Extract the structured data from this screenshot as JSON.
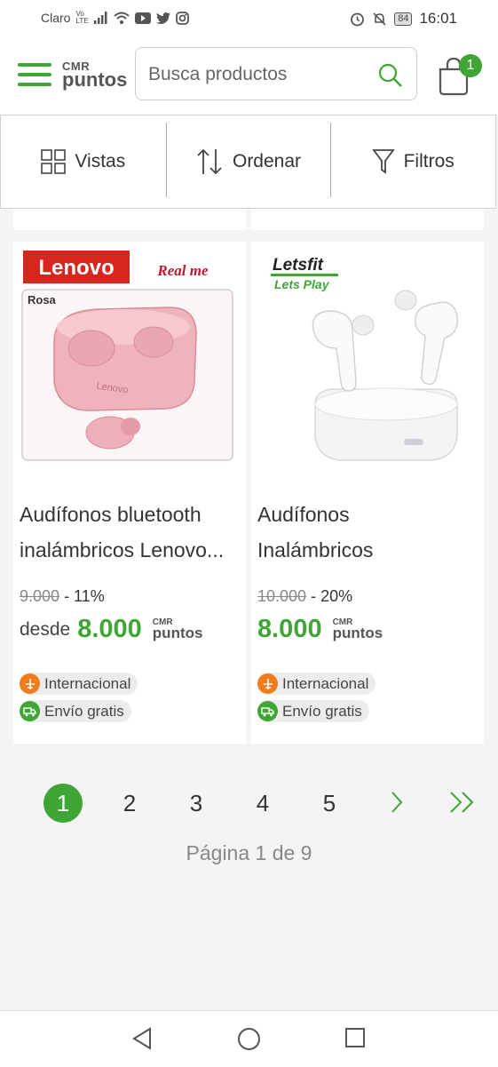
{
  "status_bar": {
    "carrier": "Claro",
    "network_top": "Vo",
    "network_bottom": "LTE",
    "battery": "84",
    "time": "16:01"
  },
  "header": {
    "logo_top": "CMR",
    "logo_bottom": "puntos",
    "search_placeholder": "Busca productos",
    "cart_count": "1"
  },
  "toolbar": {
    "views_label": "Vistas",
    "sort_label": "Ordenar",
    "filters_label": "Filtros"
  },
  "products": [
    {
      "brand_text": "Lenovo",
      "brand_sub": "Real me",
      "color_label": "Rosa",
      "product_text": "Lenovo",
      "title_line1": "Audífonos bluetooth",
      "title_line2": "inalámbricos Lenovo...",
      "old_price": "9.000",
      "discount": "- 11%",
      "price_prefix": "desde",
      "price": "8.000",
      "points_top": "CMR",
      "points_bottom": "puntos",
      "tag_international": "Internacional",
      "tag_shipping": "Envío gratis"
    },
    {
      "brand_text": "Letsfit",
      "brand_sub": "Lets Play",
      "title_line1": "Audífonos",
      "title_line2": "Inalámbricos",
      "old_price": "10.000",
      "discount": "- 20%",
      "price": "8.000",
      "points_top": "CMR",
      "points_bottom": "puntos",
      "tag_international": "Internacional",
      "tag_shipping": "Envío gratis"
    }
  ],
  "pagination": {
    "pages": [
      "1",
      "2",
      "3",
      "4",
      "5"
    ],
    "current": "1",
    "info": "Página 1 de 9"
  },
  "colors": {
    "accent": "#3fa535",
    "international": "#f07c1c",
    "shipping": "#3fa535"
  }
}
